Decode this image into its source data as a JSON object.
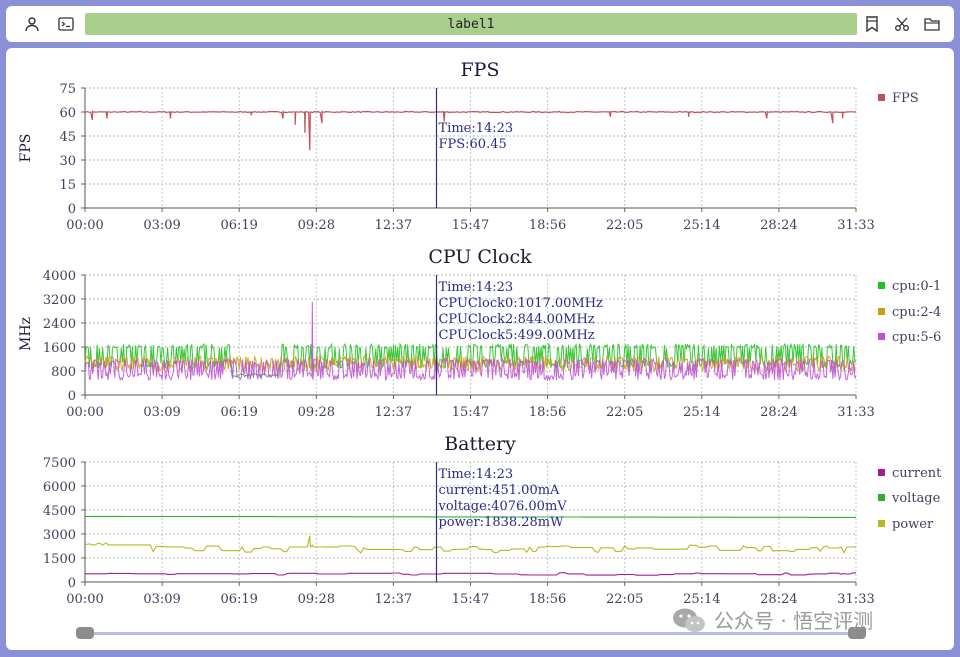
{
  "toolbar": {
    "label": "label1",
    "icons": [
      "user-icon",
      "terminal-icon",
      "bookmark-icon",
      "scissors-icon",
      "folder-icon"
    ]
  },
  "colors": {
    "fps": "#c0505a",
    "cpu0": "#22c022",
    "cpu2": "#c8a016",
    "cpu5": "#c050d8",
    "current": "#a0208c",
    "voltage": "#30b030",
    "power": "#b8b820",
    "cursor": "#303080",
    "tooltip": "#2a2a8a"
  },
  "x_ticks": [
    "00:00",
    "03:09",
    "06:19",
    "09:28",
    "12:37",
    "15:47",
    "18:56",
    "22:05",
    "25:14",
    "28:24",
    "31:33"
  ],
  "cursor_time": "14:23",
  "watermark": "公众号 · 悟空评测",
  "chart_data": [
    {
      "type": "line",
      "title": "FPS",
      "ylabel": "FPS",
      "xlabel": "",
      "ylim": [
        0,
        75
      ],
      "yticks": [
        "75",
        "60",
        "45",
        "30",
        "15",
        "0"
      ],
      "grid": true,
      "legend_position": "right",
      "series": [
        {
          "name": "FPS",
          "baseline": 60,
          "dips": [
            [
              0.3,
              55
            ],
            [
              0.9,
              56
            ],
            [
              3.5,
              56
            ],
            [
              6.8,
              58
            ],
            [
              8.1,
              56
            ],
            [
              8.6,
              52
            ],
            [
              9.0,
              47
            ],
            [
              9.2,
              36
            ],
            [
              9.7,
              53
            ],
            [
              14.7,
              54
            ],
            [
              21.5,
              57
            ],
            [
              24.7,
              57
            ],
            [
              27.9,
              56
            ],
            [
              30.6,
              53
            ],
            [
              31.0,
              56
            ]
          ]
        }
      ],
      "tooltip": [
        "Time:14:23",
        "FPS:60.45"
      ]
    },
    {
      "type": "line",
      "title": "CPU Clock",
      "ylabel": "MHz",
      "xlabel": "",
      "ylim": [
        0,
        4000
      ],
      "yticks": [
        "4000",
        "3200",
        "2400",
        "1600",
        "800",
        "0"
      ],
      "grid": true,
      "legend_position": "right",
      "series": [
        {
          "name": "cpu:0-1",
          "low": 900,
          "high": 1700
        },
        {
          "name": "cpu:2-4",
          "low": 800,
          "high": 1300
        },
        {
          "name": "cpu:5-6",
          "low": 500,
          "high": 1200,
          "spike": [
            9.3,
            3100
          ]
        }
      ],
      "tooltip": [
        "Time:14:23",
        "CPUClock0:1017.00MHz",
        "CPUClock2:844.00MHz",
        "CPUClock5:499.00MHz"
      ]
    },
    {
      "type": "line",
      "title": "Battery",
      "ylabel": "",
      "xlabel": "",
      "ylim": [
        0,
        7500
      ],
      "yticks": [
        "7500",
        "6000",
        "4500",
        "3000",
        "1500",
        "0"
      ],
      "grid": true,
      "legend_position": "right",
      "series": [
        {
          "name": "current",
          "level": 500
        },
        {
          "name": "voltage",
          "level": 4100
        },
        {
          "name": "power",
          "level": 2000,
          "peak": [
            9.2,
            2900
          ]
        }
      ],
      "tooltip": [
        "Time:14:23",
        "current:451.00mA",
        "voltage:4076.00mV",
        "power:1838.28mW"
      ]
    }
  ]
}
